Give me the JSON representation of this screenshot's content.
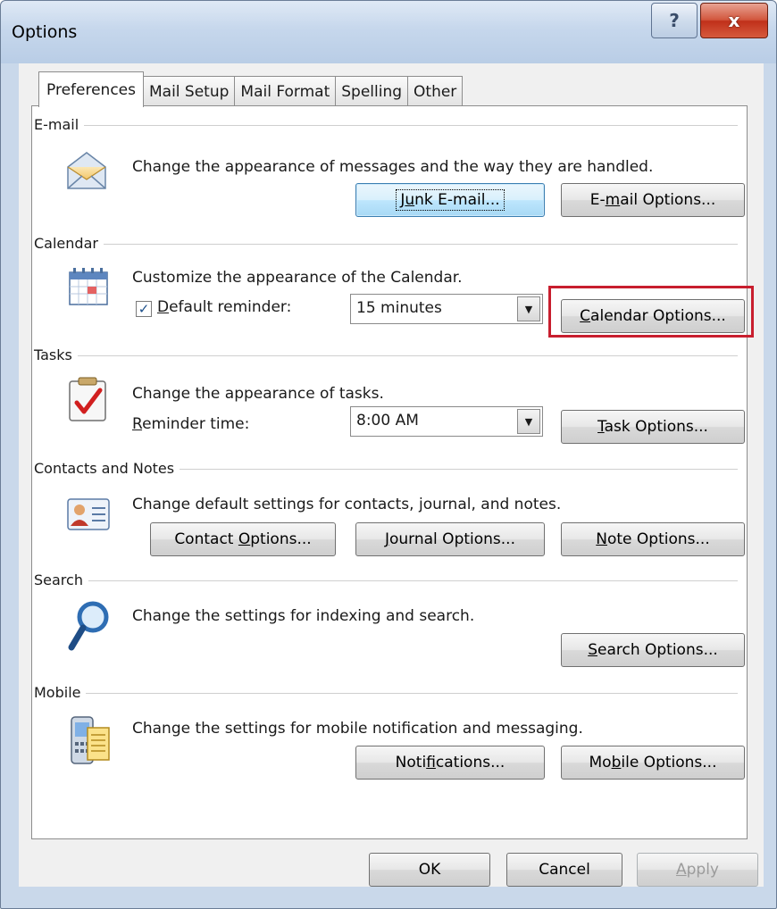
{
  "window": {
    "title": "Options",
    "help_glyph": "?",
    "close_glyph": "x"
  },
  "tabs": [
    {
      "label": "Preferences",
      "active": true
    },
    {
      "label": "Mail Setup",
      "active": false
    },
    {
      "label": "Mail Format",
      "active": false
    },
    {
      "label": "Spelling",
      "active": false
    },
    {
      "label": "Other",
      "active": false
    }
  ],
  "sections": {
    "email": {
      "label": "E-mail",
      "icon": "envelope-icon",
      "description": "Change the appearance of messages and the way they are handled.",
      "junk_button": {
        "pre": "J",
        "mnemonic": "u",
        "post": "nk E-mail..."
      },
      "options_button": {
        "pre": "E-",
        "mnemonic": "m",
        "post": "ail Options..."
      }
    },
    "calendar": {
      "label": "Calendar",
      "icon": "calendar-icon",
      "description": "Customize the appearance of the Calendar.",
      "checkbox_checked": true,
      "checkbox_glyph": "✓",
      "reminder_label": {
        "pre": "",
        "mnemonic": "D",
        "post": "efault reminder:"
      },
      "reminder_value": "15 minutes",
      "options_button": {
        "pre": "",
        "mnemonic": "C",
        "post": "alendar Options..."
      }
    },
    "tasks": {
      "label": "Tasks",
      "icon": "task-clipboard-icon",
      "description": "Change the appearance of tasks.",
      "reminder_label": {
        "pre": "",
        "mnemonic": "R",
        "post": "eminder time:"
      },
      "reminder_value": "8:00 AM",
      "options_button": {
        "pre": "",
        "mnemonic": "T",
        "post": "ask Options..."
      }
    },
    "contacts": {
      "label": "Contacts and Notes",
      "icon": "contact-card-icon",
      "description": "Change default settings for contacts, journal, and notes.",
      "contact_button": {
        "pre": "Contact ",
        "mnemonic": "O",
        "post": "ptions..."
      },
      "journal_button": {
        "pre": "",
        "mnemonic": "J",
        "post": "ournal Options..."
      },
      "note_button": {
        "pre": "",
        "mnemonic": "N",
        "post": "ote Options..."
      }
    },
    "search": {
      "label": "Search",
      "icon": "magnifier-icon",
      "description": "Change the settings for indexing and search.",
      "options_button": {
        "pre": "",
        "mnemonic": "S",
        "post": "earch Options..."
      }
    },
    "mobile": {
      "label": "Mobile",
      "icon": "mobile-device-icon",
      "description": "Change the settings for mobile notification and messaging.",
      "notifications_button": {
        "pre": "Noti",
        "mnemonic": "f",
        "post": "ications..."
      },
      "options_button": {
        "pre": "Mo",
        "mnemonic": "b",
        "post": "ile Options..."
      }
    }
  },
  "footer": {
    "ok_label": "OK",
    "cancel_label": "Cancel",
    "apply_label": {
      "pre": "",
      "mnemonic": "A",
      "post": "pply"
    }
  },
  "colors": {
    "highlight_box": "#c81e2e",
    "dialog_face": "#f0f0f0",
    "frame": "#c9d8ea"
  }
}
